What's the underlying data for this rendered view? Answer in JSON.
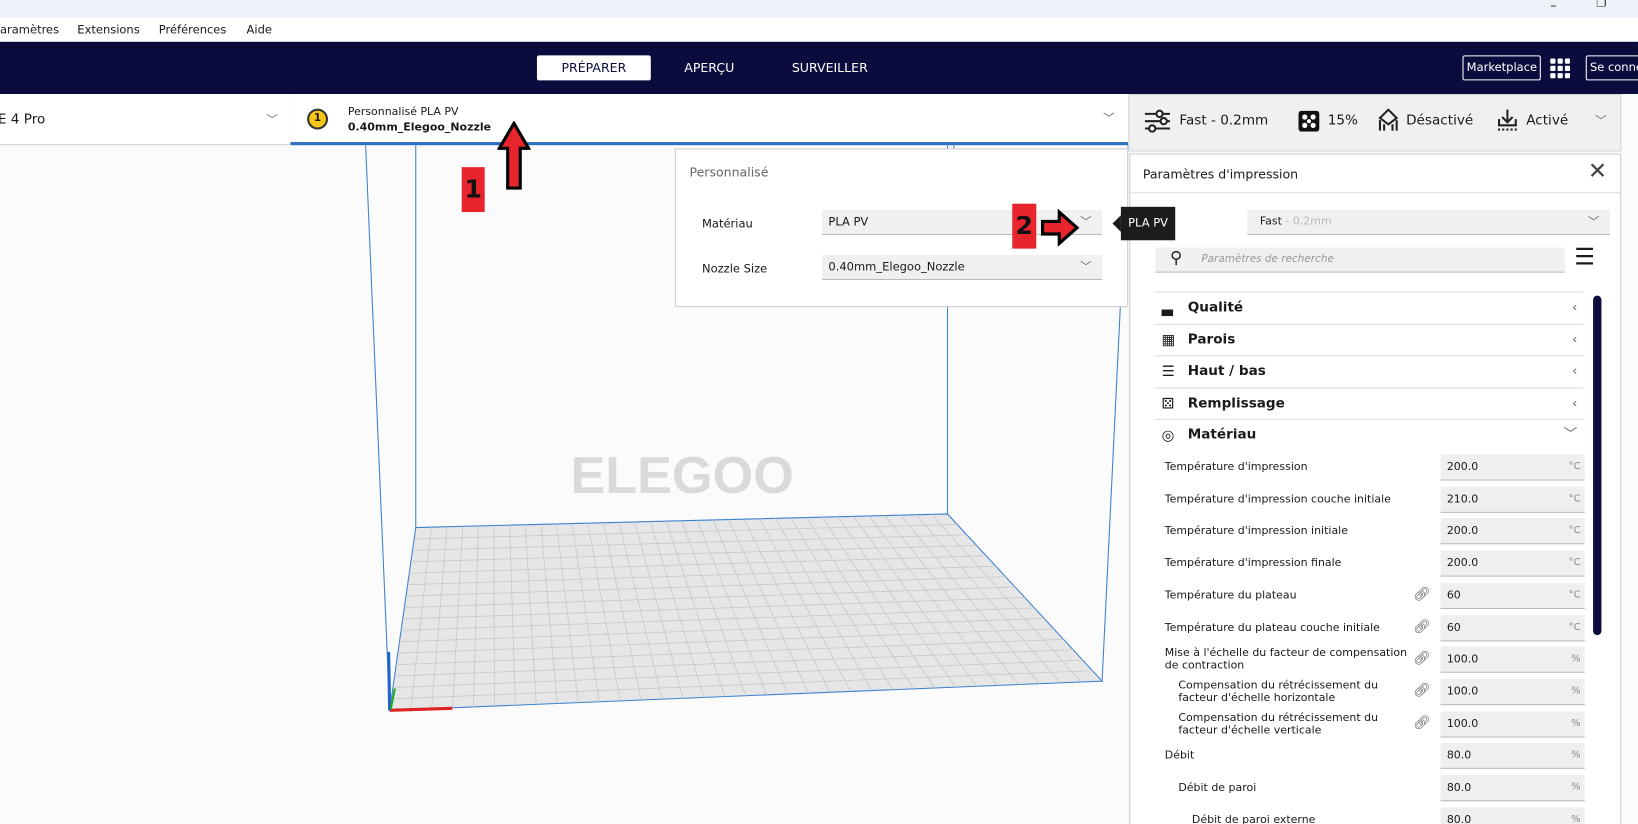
{
  "menu": [
    "aramètres",
    "Extensions",
    "Préférences",
    "Aide"
  ],
  "tabs": [
    "PRÉPARER",
    "APERÇU",
    "SURVEILLER"
  ],
  "header": {
    "marketplace": "Marketplace",
    "signin": "Se connecter"
  },
  "printer": {
    "name": "E 4 Pro"
  },
  "material_selector": {
    "badge": "1",
    "material": "Personnalisé PLA PV",
    "nozzle": "0.40mm_Elegoo_Nozzle"
  },
  "print_bar": {
    "profile": "Fast - 0.2mm",
    "infill": "15%",
    "support": "Désactivé",
    "adhesion": "Activé"
  },
  "popup": {
    "title": "Personnalisé",
    "material_label": "Matériau",
    "material_value": "PLA PV",
    "nozzle_label": "Nozzle Size",
    "nozzle_value": "0.40mm_Elegoo_Nozzle"
  },
  "tooltip": "PLA PV",
  "viewport": {
    "watermark": "ELEGOO"
  },
  "annotations": [
    "1",
    "2"
  ],
  "panel": {
    "title": "Paramètres d'impression",
    "profile_name": "Fast",
    "profile_suffix": " - 0.2mm",
    "search_placeholder": "Paramètres de recherche",
    "categories": [
      "Qualité",
      "Parois",
      "Haut / bas",
      "Remplissage",
      "Matériau"
    ],
    "settings": [
      {
        "label": "Température d'impression",
        "value": "200.0",
        "unit": "°C"
      },
      {
        "label": "Température d'impression couche initiale",
        "value": "210.0",
        "unit": "°C"
      },
      {
        "label": "Température d'impression initiale",
        "value": "200.0",
        "unit": "°C"
      },
      {
        "label": "Température d'impression finale",
        "value": "200.0",
        "unit": "°C"
      },
      {
        "label": "Température du plateau",
        "value": "60",
        "unit": "°C"
      },
      {
        "label": "Température du plateau couche initiale",
        "value": "60",
        "unit": "°C"
      },
      {
        "label": "Mise à l'échelle du facteur de compensation de contraction",
        "value": "100.0",
        "unit": "%"
      },
      {
        "label": "Compensation du rétrécissement du facteur d'échelle horizontale",
        "value": "100.0",
        "unit": "%"
      },
      {
        "label": "Compensation du rétrécissement du facteur d'échelle verticale",
        "value": "100.0",
        "unit": "%"
      },
      {
        "label": "Débit",
        "value": "80.0",
        "unit": "%"
      },
      {
        "label": "Débit de paroi",
        "value": "80.0",
        "unit": "%"
      },
      {
        "label": "Débit de paroi externe",
        "value": "80.0",
        "unit": "%"
      }
    ]
  }
}
